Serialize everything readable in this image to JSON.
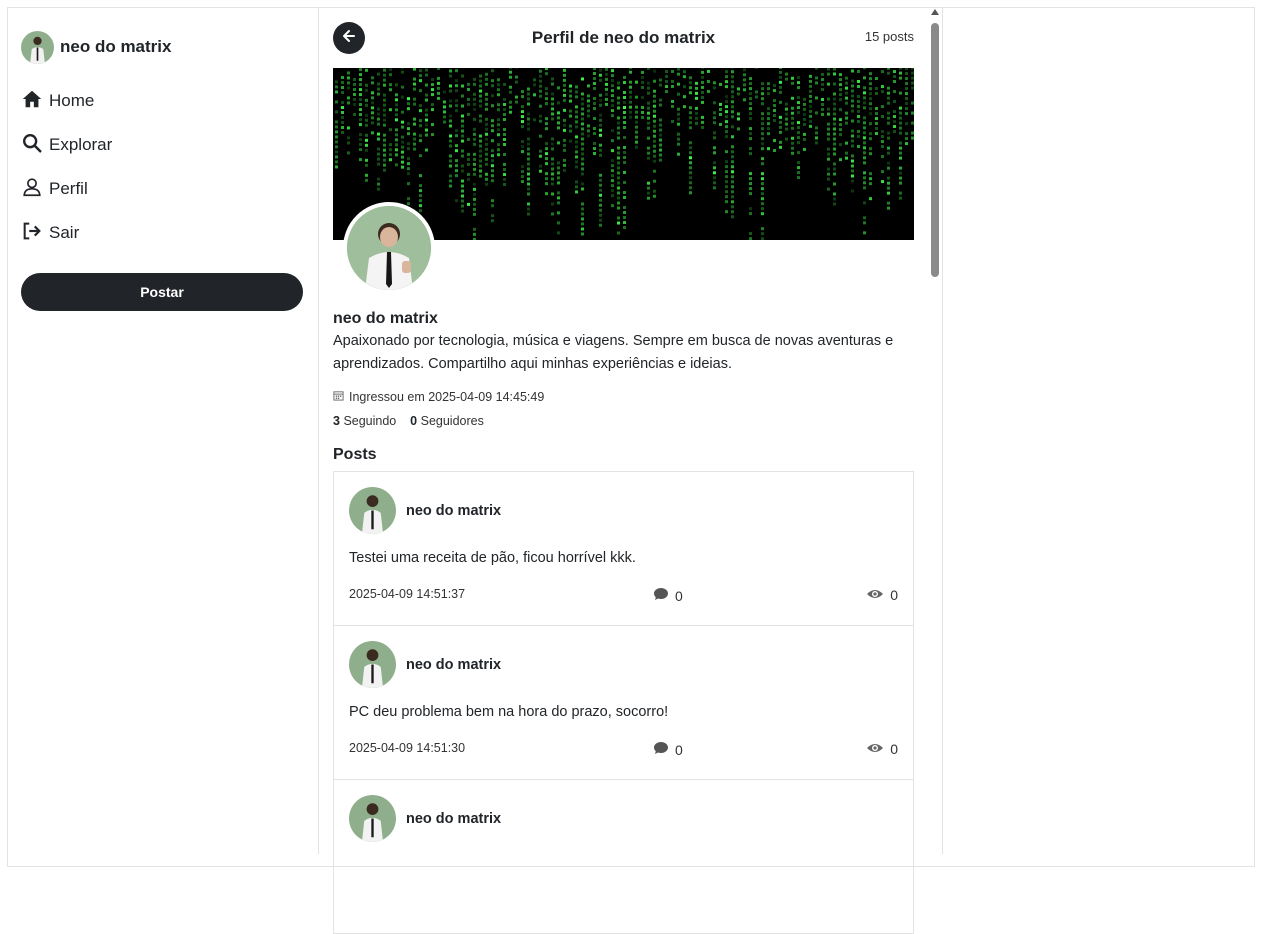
{
  "sidebar": {
    "user_name": "neo do matrix",
    "nav": [
      {
        "label": "Home",
        "icon": "home-icon"
      },
      {
        "label": "Explorar",
        "icon": "search-icon"
      },
      {
        "label": "Perfil",
        "icon": "user-icon"
      },
      {
        "label": "Sair",
        "icon": "logout-icon"
      }
    ],
    "post_button": "Postar"
  },
  "header": {
    "title": "Perfil de neo do matrix",
    "post_count": "15 posts"
  },
  "profile": {
    "name": "neo do matrix",
    "bio": "Apaixonado por tecnologia, música e viagens. Sempre em busca de novas aventuras e aprendizados. Compartilho aqui minhas experiências e ideias.",
    "joined": "Ingressou em 2025-04-09 14:45:49",
    "following_count": "3",
    "following_label": "Seguindo",
    "followers_count": "0",
    "followers_label": "Seguidores"
  },
  "posts_heading": "Posts",
  "posts": [
    {
      "author": "neo do matrix",
      "text": "Testei uma receita de pão, ficou horrível kkk.",
      "date": "2025-04-09 14:51:37",
      "comments": "0",
      "views": "0"
    },
    {
      "author": "neo do matrix",
      "text": "PC deu problema bem na hora do prazo, socorro!",
      "date": "2025-04-09 14:51:30",
      "comments": "0",
      "views": "0"
    },
    {
      "author": "neo do matrix",
      "text": "",
      "date": "",
      "comments": "",
      "views": ""
    }
  ],
  "colors": {
    "dark": "#212529",
    "banner_green": "#3fbf3f",
    "border": "#e3e3e3"
  }
}
